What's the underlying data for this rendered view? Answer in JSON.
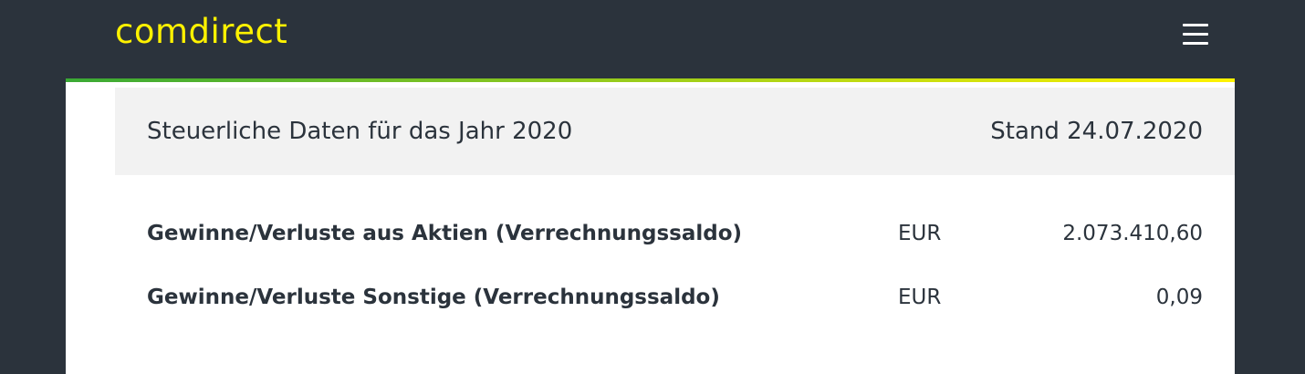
{
  "brand": {
    "name": "comdirect",
    "color": "#fff200"
  },
  "header": {
    "menu_icon": "hamburger-menu-icon",
    "accent_gradient": [
      "#3aa935",
      "#fff200"
    ]
  },
  "tax_section": {
    "title": "Steuerliche Daten für das Jahr 2020",
    "date": "Stand 24.07.2020",
    "rows": [
      {
        "label": "Gewinne/Verluste aus Aktien (Verrechnungssaldo)",
        "currency": "EUR",
        "value": "2.073.410,60"
      },
      {
        "label": "Gewinne/Verluste Sonstige (Verrechnungssaldo)",
        "currency": "EUR",
        "value": "0,09"
      }
    ]
  }
}
